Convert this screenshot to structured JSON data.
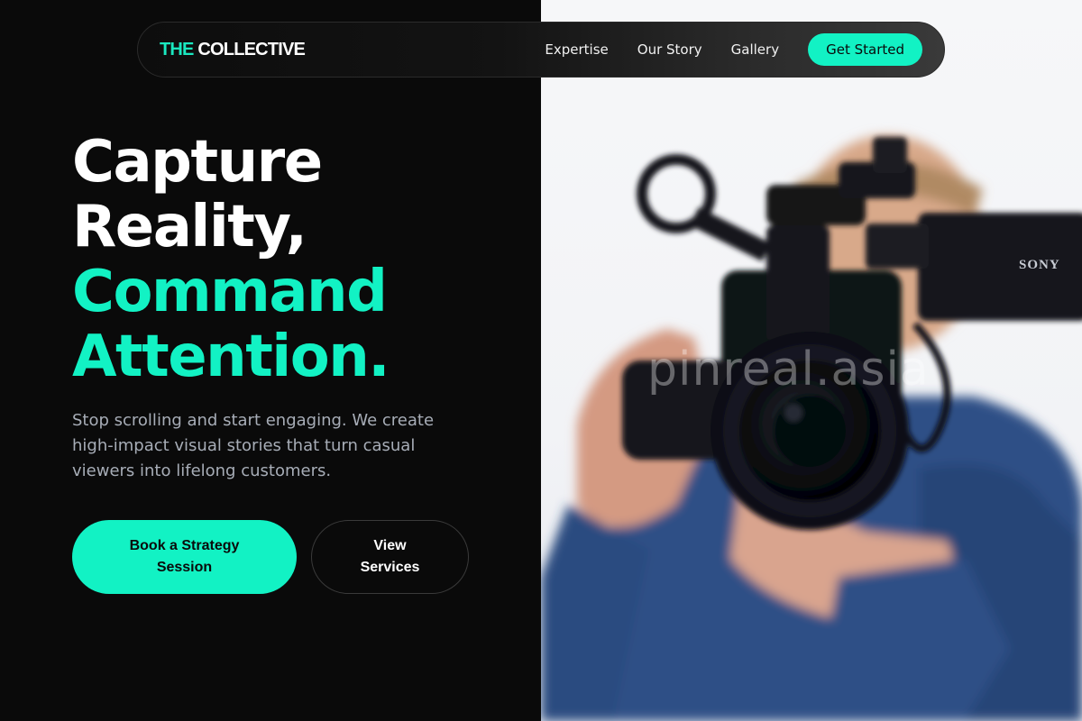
{
  "brand": {
    "prefix": "THE",
    "name": "COLLECTIVE"
  },
  "nav": {
    "links": [
      "Expertise",
      "Our Story",
      "Gallery"
    ],
    "cta": "Get Started"
  },
  "hero": {
    "headline_lines": [
      "Capture",
      "Reality,"
    ],
    "headline_accent_lines": [
      "Command",
      "Attention."
    ],
    "subtext": "Stop scrolling and start engaging. We create high-impact visual stories that turn casual viewers into lifelong customers.",
    "primary_button": "Book a Strategy Session",
    "secondary_button": "View Services"
  },
  "photo": {
    "camera_brand": "SONY",
    "watermark": "pinreal.asia"
  },
  "colors": {
    "accent": "#12f2c4",
    "background": "#0a0a0a",
    "subtext": "#a7adb7"
  }
}
